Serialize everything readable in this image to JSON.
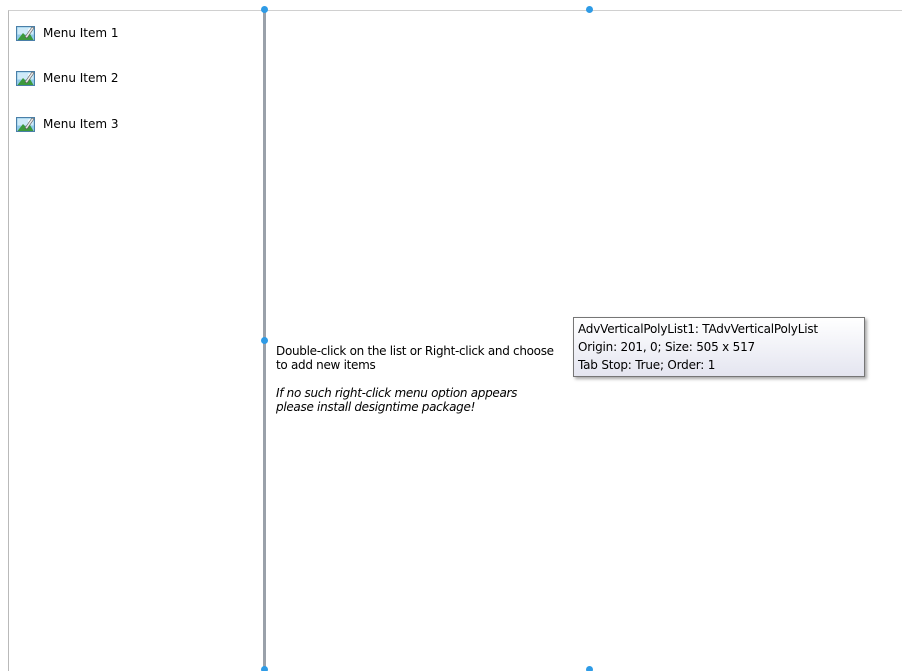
{
  "left_panel": {
    "items": [
      {
        "label": "Menu Item 1",
        "icon": "picture-icon"
      },
      {
        "label": "Menu Item 2",
        "icon": "picture-icon"
      },
      {
        "label": "Menu Item 3",
        "icon": "picture-icon"
      }
    ]
  },
  "design_hint": {
    "line1": "Double-click on the list or Right-click and choose",
    "line2": "to add new items",
    "italic1": "If no such right-click menu option appears",
    "italic2": "please install designtime package!"
  },
  "tooltip": {
    "line1": "AdvVerticalPolyList1: TAdvVerticalPolyList",
    "line2": "Origin: 201, 0; Size: 505 x 517",
    "line3": "Tab Stop: True; Order: 1"
  },
  "colors": {
    "selection_handle": "#2e9be6",
    "splitter": "#9aa1aa"
  }
}
